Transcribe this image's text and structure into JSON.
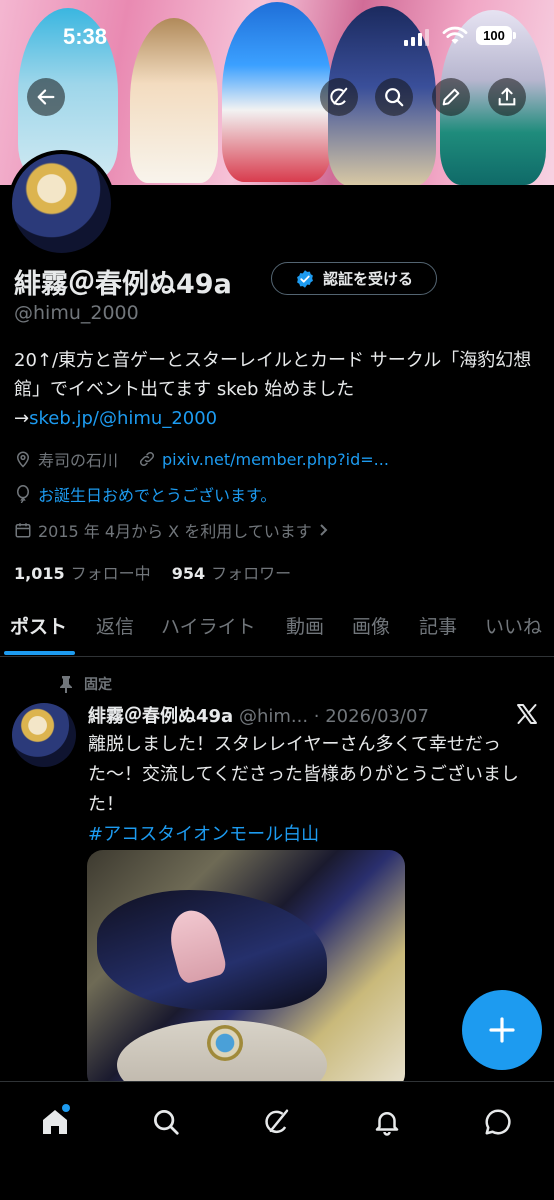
{
  "status_bar": {
    "time": "5:38",
    "battery": "100"
  },
  "header": {
    "buttons": [
      "back-icon",
      "grok-icon",
      "search-icon",
      "edit-icon",
      "share-icon"
    ]
  },
  "profile": {
    "display_name": "緋霧＠春例ぬ49a",
    "verify_button": "認証を受ける",
    "handle": "@himu_2000",
    "bio_text": "20↑/東方と音ゲーとスターレイルとカード サークル「海豹幻想館」でイベント出てます skeb 始めました →",
    "bio_link": "skeb.jp/@himu_2000",
    "location": "寿司の石川",
    "website": "pixiv.net/member.php?id=...",
    "birthday": "お誕生日おめでとうございます。",
    "joined": "2015 年 4月から X を利用しています",
    "following_count": "1,015",
    "following_label": "フォロー中",
    "followers_count": "954",
    "followers_label": "フォロワー"
  },
  "tabs": [
    {
      "label": "ポスト",
      "active": true
    },
    {
      "label": "返信"
    },
    {
      "label": "ハイライト"
    },
    {
      "label": "動画"
    },
    {
      "label": "画像"
    },
    {
      "label": "記事"
    },
    {
      "label": "いいね"
    }
  ],
  "post": {
    "pinned_label": "固定",
    "author": "緋霧＠春例ぬ49a",
    "handle_date": "@him... · 2026/03/07",
    "text": "離脱しました！スタレレイヤーさん多くて幸せだった〜！交流してくださった皆様ありがとうございました！",
    "hashtag": "#アコスタイオンモール白山"
  },
  "bottom_nav": [
    "home-icon",
    "search-icon",
    "grok-icon",
    "notifications-icon",
    "messages-icon"
  ],
  "colors": {
    "accent": "#1d9bf0",
    "background": "#000000",
    "text": "#e7e9ea",
    "muted": "#71767b"
  }
}
